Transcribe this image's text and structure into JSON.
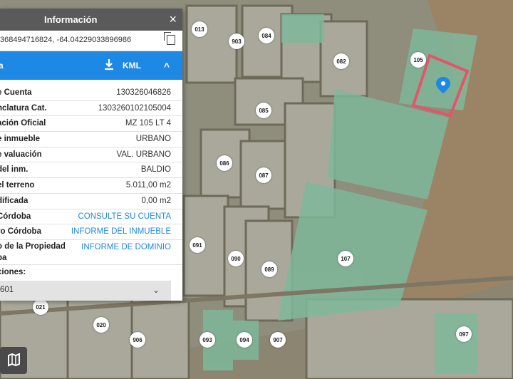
{
  "panel": {
    "title": "Información",
    "close_label": "×",
    "coordinates": "368494716824, -64.04229033896986",
    "blue_bar_left": "a",
    "kml_label": "KML",
    "collapse_label": "^",
    "rows": [
      {
        "key": "e Cuenta",
        "value": "130326046826",
        "link": false
      },
      {
        "key": "nclatura Cat.",
        "value": "1303260102105004",
        "link": false
      },
      {
        "key": "ación Oficial",
        "value": "MZ 105 LT 4",
        "link": false
      },
      {
        "key": "e inmueble",
        "value": "URBANO",
        "link": false
      },
      {
        "key": "e valuación",
        "value": "VAL. URBANO",
        "link": false
      },
      {
        "key": "del inm.",
        "value": "BALDIO",
        "link": false
      },
      {
        "key": "el terreno",
        "value": "5.011,00 m2",
        "link": false
      },
      {
        "key": "dificada",
        "value": "0,00 m2",
        "link": false
      },
      {
        "key": "Córdoba",
        "value": "CONSULTE SU CUENTA",
        "link": true
      },
      {
        "key": "ro Córdoba",
        "value": "INFORME DEL INMUEBLE",
        "link": true
      },
      {
        "key": "o de la Propiedad\nba",
        "value": "INFORME DE DOMINIO",
        "link": true
      }
    ],
    "observations_label": "ciones:",
    "observations_value": "601",
    "observations_chevron": "⌄"
  },
  "map": {
    "parcel_labels": [
      "013",
      "903",
      "084",
      "082",
      "105",
      "085",
      "086",
      "087",
      "091",
      "090",
      "089",
      "107",
      "021",
      "020",
      "906",
      "093",
      "094",
      "907",
      "097"
    ]
  },
  "colors": {
    "header": "#5a5a5a",
    "accent": "#1e88e5",
    "highlight_parcel": "#e2566a",
    "green_parcel": "#7fb89a"
  },
  "icons": {
    "copy": "copy-icon",
    "download": "download-icon",
    "pin": "location-pin-icon",
    "layers": "layers-icon"
  }
}
